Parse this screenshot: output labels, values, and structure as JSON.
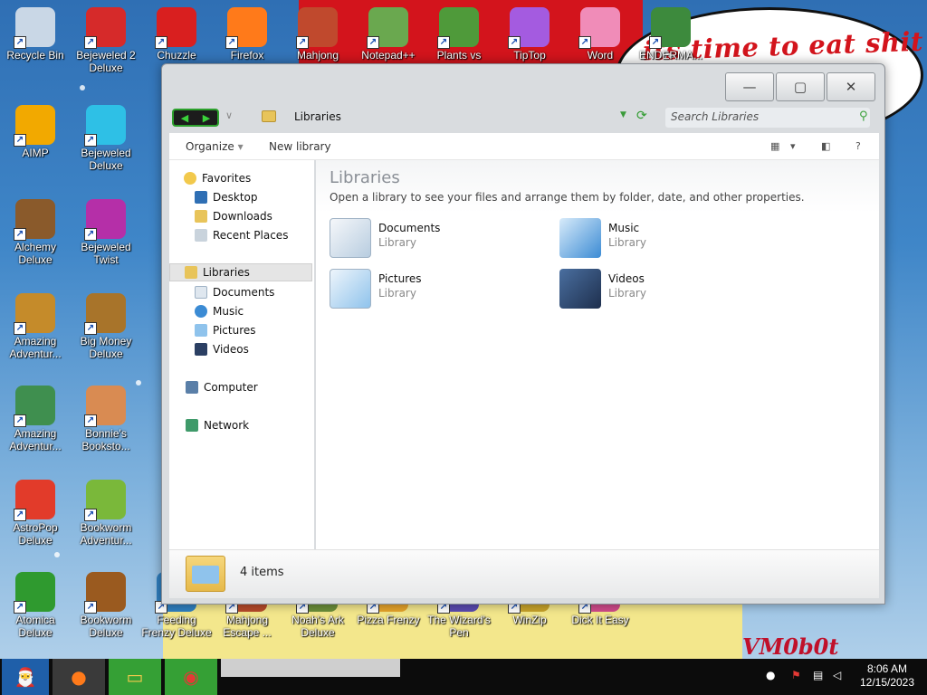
{
  "wallpaper": {
    "graffiti": "its time to eat shit",
    "signature": "VM0b0t"
  },
  "desktop": {
    "icons": [
      {
        "label": "Recycle Bin",
        "icon": "recycle-bin-icon",
        "color": "#c9d7e6"
      },
      {
        "label": "Bejeweled 2 Deluxe",
        "icon": "bejeweled2-icon",
        "color": "#d62a2a"
      },
      {
        "label": "Chuzzle",
        "icon": "chuzzle-icon",
        "color": "#d91f1f"
      },
      {
        "label": "Firefox",
        "icon": "firefox-icon",
        "color": "#ff7a1a"
      },
      {
        "label": "Mahjong",
        "icon": "mahjong-icon",
        "color": "#c0492d"
      },
      {
        "label": "Notepad++",
        "icon": "notepadpp-icon",
        "color": "#6aa84f"
      },
      {
        "label": "Plants vs",
        "icon": "plants-vs-zombies-icon",
        "color": "#4f9a3a"
      },
      {
        "label": "TipTop",
        "icon": "tiptop-icon",
        "color": "#a45be0"
      },
      {
        "label": "Word",
        "icon": "word-icon",
        "color": "#f08cb8"
      },
      {
        "label": "ENDERMA...",
        "icon": "enderman-icon",
        "color": "#3d8a3d"
      },
      {
        "label": "AIMP",
        "icon": "aimp-icon",
        "color": "#f2a900"
      },
      {
        "label": "Bejeweled Deluxe",
        "icon": "bejeweled-icon",
        "color": "#2ec0e6"
      },
      {
        "label": "Alchemy Deluxe",
        "icon": "alchemy-icon",
        "color": "#8a5a2b"
      },
      {
        "label": "Bejeweled Twist",
        "icon": "bejeweled-twist-icon",
        "color": "#b52fa8"
      },
      {
        "label": "Amazing Adventur...",
        "icon": "amazing-adventures-icon",
        "color": "#c58b2a"
      },
      {
        "label": "Big Money Deluxe",
        "icon": "big-money-icon",
        "color": "#a8742a"
      },
      {
        "label": "Amazing Adventur...",
        "icon": "amazing-adventures-2-icon",
        "color": "#3f8f4f"
      },
      {
        "label": "Bonnie's Booksto...",
        "icon": "bonnies-bookstore-icon",
        "color": "#d98b52"
      },
      {
        "label": "AstroPop Deluxe",
        "icon": "astropop-icon",
        "color": "#e23b2a"
      },
      {
        "label": "Bookworm Adventur...",
        "icon": "bookworm-adventures-icon",
        "color": "#7ab83a"
      },
      {
        "label": "Atomica Deluxe",
        "icon": "atomica-icon",
        "color": "#2f9a2f"
      },
      {
        "label": "Bookworm Deluxe",
        "icon": "bookworm-icon",
        "color": "#9a5a1f"
      },
      {
        "label": "Feeding Frenzy Deluxe",
        "icon": "feeding-frenzy-icon",
        "color": "#2f7fc0"
      },
      {
        "label": "Mahjong Escape ...",
        "icon": "mahjong-escape-icon",
        "color": "#b64a2a"
      },
      {
        "label": "Noah's Ark Deluxe",
        "icon": "noahs-ark-icon",
        "color": "#6b8e3a"
      },
      {
        "label": "Pizza Frenzy",
        "icon": "pizza-frenzy-icon",
        "color": "#e5a32a"
      },
      {
        "label": "The Wizard's Pen",
        "icon": "wizards-pen-icon",
        "color": "#5a4ab0"
      },
      {
        "label": "WinZip",
        "icon": "winzip-icon",
        "color": "#c7a22a"
      },
      {
        "label": "Dick It Easy",
        "icon": "dick-it-easy-icon",
        "color": "#d04a8a"
      }
    ]
  },
  "window": {
    "controls": {
      "minimize": "—",
      "maximize": "▢",
      "close": "✕"
    },
    "address": {
      "path": "Libraries"
    },
    "search": {
      "placeholder": "Search Libraries"
    },
    "toolbar": {
      "organize": "Organize",
      "new_library": "New library",
      "help": "?"
    },
    "nav": {
      "favorites": {
        "label": "Favorites",
        "items": [
          "Desktop",
          "Downloads",
          "Recent Places"
        ]
      },
      "libraries": {
        "label": "Libraries",
        "items": [
          "Documents",
          "Music",
          "Pictures",
          "Videos"
        ]
      },
      "computer": "Computer",
      "network": "Network"
    },
    "content": {
      "title": "Libraries",
      "subtitle": "Open a library to see your files and arrange them by folder, date, and other properties.",
      "libraries": [
        {
          "name": "Documents",
          "type": "Library",
          "icon": "documents-library-icon"
        },
        {
          "name": "Music",
          "type": "Library",
          "icon": "music-library-icon"
        },
        {
          "name": "Pictures",
          "type": "Library",
          "icon": "pictures-library-icon"
        },
        {
          "name": "Videos",
          "type": "Library",
          "icon": "videos-library-icon"
        }
      ]
    },
    "status": {
      "count": "4 items"
    }
  },
  "taskbar": {
    "apps": [
      "start-santa-icon",
      "firefox-icon",
      "explorer-icon",
      "chrome-icon"
    ],
    "clock": {
      "time": "8:06 AM",
      "date": "12/15/2023"
    }
  }
}
